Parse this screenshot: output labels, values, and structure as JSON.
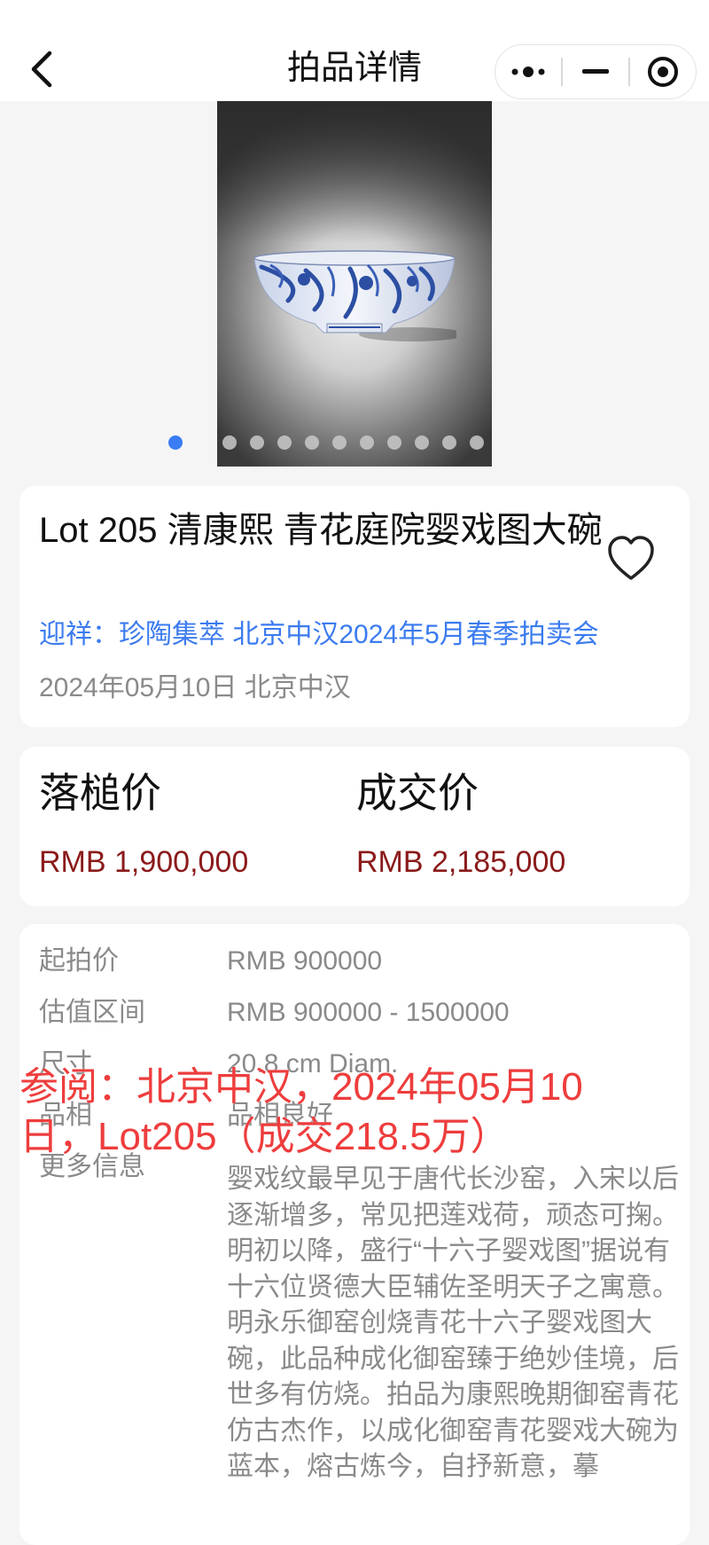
{
  "header": {
    "title": "拍品详情",
    "back_icon": "chevron-left-icon",
    "capsule": {
      "more_icon": "more-dots-icon",
      "minimize_icon": "minimize-icon",
      "close_icon": "target-close-icon"
    }
  },
  "carousel": {
    "image_subject": "blue-and-white porcelain bowl",
    "slide_count": 12,
    "active_index": 0,
    "active_color": "#3a7cf3"
  },
  "lot": {
    "title": "Lot 205 清康熙 青花庭院婴戏图大碗",
    "auction_link": "迎祥：珍陶集萃 北京中汉2024年5月春季拍卖会",
    "date_house": "2024年05月10日 北京中汉",
    "favorite_icon": "heart-outline-icon",
    "link_color": "#3b7bef"
  },
  "prices": {
    "hammer_label": "落槌价",
    "hammer_value": "RMB 1,900,000",
    "sold_label": "成交价",
    "sold_value": "RMB 2,185,000",
    "value_color": "#8b1a1a"
  },
  "details": {
    "start_label": "起拍价",
    "start_value": "RMB 900000",
    "estimate_label": "估值区间",
    "estimate_value": "RMB 900000 - 1500000",
    "size_label": "尺寸",
    "size_value": "20.8 cm Diam.",
    "condition_label": "品相",
    "condition_value": "品相良好",
    "more_label": "更多信息",
    "more_value": "婴戏纹最早见于唐代长沙窑，入宋以后逐渐增多，常见把莲戏荷，顽态可掬。明初以降，盛行“十六子婴戏图”据说有十六位贤德大臣辅佐圣明天子之寓意。明永乐御窑创烧青花十六子婴戏图大碗，此品种成化御窑臻于绝妙佳境，后世多有仿烧。拍品为康熙晚期御窑青花仿古杰作，以成化御窑青花婴戏大碗为蓝本，熔古炼今，自抒新意，摹"
  },
  "overlay": {
    "text": "参阅：北京中汉，2024年05月10日，Lot205（成交218.5万）",
    "color": "#ee3d3d"
  }
}
